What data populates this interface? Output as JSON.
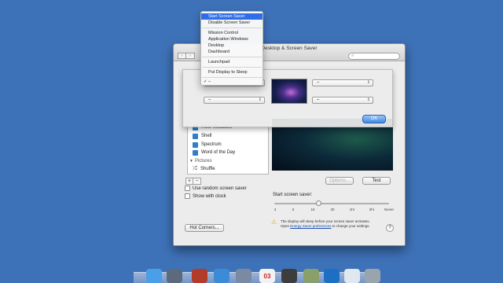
{
  "window": {
    "title": "Desktop & Screen Saver",
    "nav_back": "‹",
    "nav_forward": "›",
    "search_glyph": "⌕"
  },
  "list": {
    "items": [
      {
        "label": "RSS Visualizer",
        "kind": "saver"
      },
      {
        "label": "Shell",
        "kind": "saver"
      },
      {
        "label": "Spectrum",
        "kind": "saver"
      },
      {
        "label": "Word of the Day",
        "kind": "saver"
      }
    ],
    "group_label": "Pictures",
    "shuffle_label": "Shuffle"
  },
  "controls": {
    "add_label": "+",
    "remove_label": "−",
    "random_label": "Use random screen saver",
    "clock_label": "Show with clock",
    "options_label": "Options...",
    "test_label": "Test",
    "hot_corners_label": "Hot Corners...",
    "help_label": "?"
  },
  "slider": {
    "label": "Start screen saver:",
    "ticks": [
      "3",
      "5",
      "15",
      "30",
      "1hr",
      "2hr",
      "Never"
    ],
    "value_minutes": 20
  },
  "warning": {
    "text": "The display will sleep before your screen saver activates.",
    "link_prefix": "Open ",
    "link": "Energy Saver preferences",
    "suffix": " to change your settings."
  },
  "sheet": {
    "top_left": "–",
    "top_right": "–",
    "bottom_left": "–",
    "bottom_right": "–",
    "ok_label": "OK"
  },
  "menu": {
    "items": [
      {
        "label": "Start Screen Saver",
        "selected": true
      },
      {
        "label": "Disable Screen Saver"
      },
      {
        "label": "Mission Control"
      },
      {
        "label": "Application Windows"
      },
      {
        "label": "Desktop"
      },
      {
        "label": "Dashboard"
      },
      {
        "label": "Launchpad"
      },
      {
        "label": "Put Display to Sleep"
      },
      {
        "label": "–",
        "checked": true
      }
    ],
    "check_glyph": "✓"
  },
  "dock": {
    "icons": [
      {
        "name": "finder-icon",
        "color": "#4aa0e8"
      },
      {
        "name": "launchpad-icon",
        "color": "#5b6a7d"
      },
      {
        "name": "photo-booth-icon",
        "color": "#b33b2a"
      },
      {
        "name": "safari-icon",
        "color": "#3c8bd8"
      },
      {
        "name": "mail-icon",
        "color": "#7a8aa0"
      },
      {
        "name": "calendar-icon",
        "color": "#f2f2f2"
      },
      {
        "name": "activity-monitor-icon",
        "color": "#3d3d3d"
      },
      {
        "name": "preview-icon",
        "color": "#8aa06a"
      },
      {
        "name": "preferences-icon",
        "color": "#1d6fc4"
      },
      {
        "name": "document-icon",
        "color": "#dfe7ef"
      },
      {
        "name": "trash-icon",
        "color": "#9aa4ad"
      }
    ],
    "calendar_day": "03"
  },
  "colors": {
    "desktop": "#3e72b8",
    "menu_highlight": "#2f6ee6",
    "default_button": "#3f8ae5"
  }
}
